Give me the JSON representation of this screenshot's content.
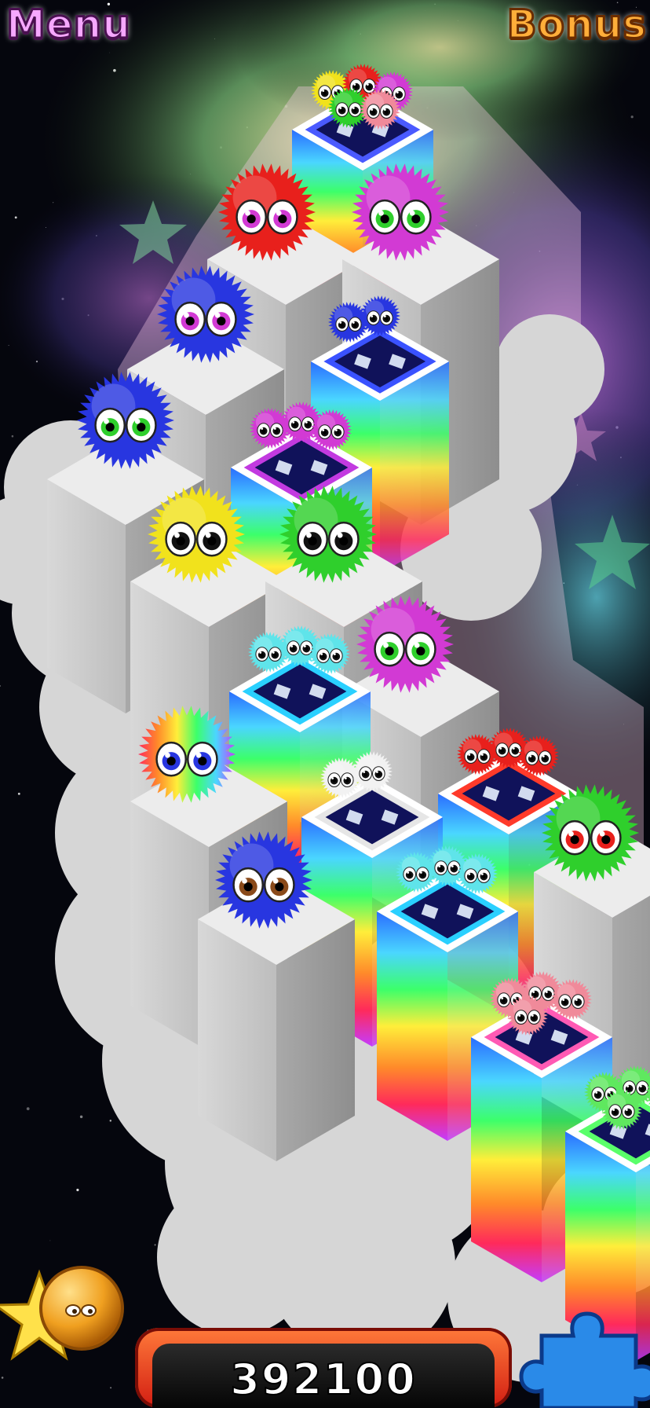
{
  "hud": {
    "menu_label": "Menu",
    "bonus_label": "Bonus",
    "score": "392100",
    "powerup_icon": "star-fuzzball-icon",
    "puzzle_icon": "puzzle-piece-icon"
  },
  "colors": {
    "red": "#e8201c",
    "magenta": "#d23ad4",
    "blue": "#2836e0",
    "yellow": "#f1e21c",
    "green": "#2fcf2c",
    "cyan": "#5fe4ea",
    "white": "#f2f2f2",
    "pink": "#f08a9a",
    "light_green": "#5fe85f",
    "brown_eye": "#8a4a1a",
    "score_frame": "#e0281a"
  },
  "board": {
    "pillars": [
      {
        "kind": "white",
        "occupant": "red",
        "eye": "magenta"
      },
      {
        "kind": "white",
        "occupant": "magenta",
        "eye": "green"
      },
      {
        "kind": "white",
        "occupant": "blue",
        "eye": "magenta"
      },
      {
        "kind": "white",
        "occupant": "blue",
        "eye": "green"
      },
      {
        "kind": "white",
        "occupant": "yellow",
        "eye": "black"
      },
      {
        "kind": "white",
        "occupant": "green",
        "eye": "black"
      },
      {
        "kind": "white",
        "occupant": "magenta",
        "eye": "green"
      },
      {
        "kind": "white",
        "occupant": "rainbow",
        "eye": "blue"
      },
      {
        "kind": "white",
        "occupant": "blue",
        "eye": "brown"
      },
      {
        "kind": "white",
        "occupant": "green",
        "eye": "red"
      }
    ],
    "portals": [
      {
        "color": "mixed",
        "babies": 5
      },
      {
        "color": "blue",
        "babies": 2
      },
      {
        "color": "magenta",
        "babies": 3
      },
      {
        "color": "cyan",
        "babies": 3
      },
      {
        "color": "white",
        "babies": 2
      },
      {
        "color": "red",
        "babies": 3
      },
      {
        "color": "cyan",
        "babies": 3
      },
      {
        "color": "pink",
        "babies": 4
      },
      {
        "color": "light_green",
        "babies": 4
      }
    ]
  }
}
